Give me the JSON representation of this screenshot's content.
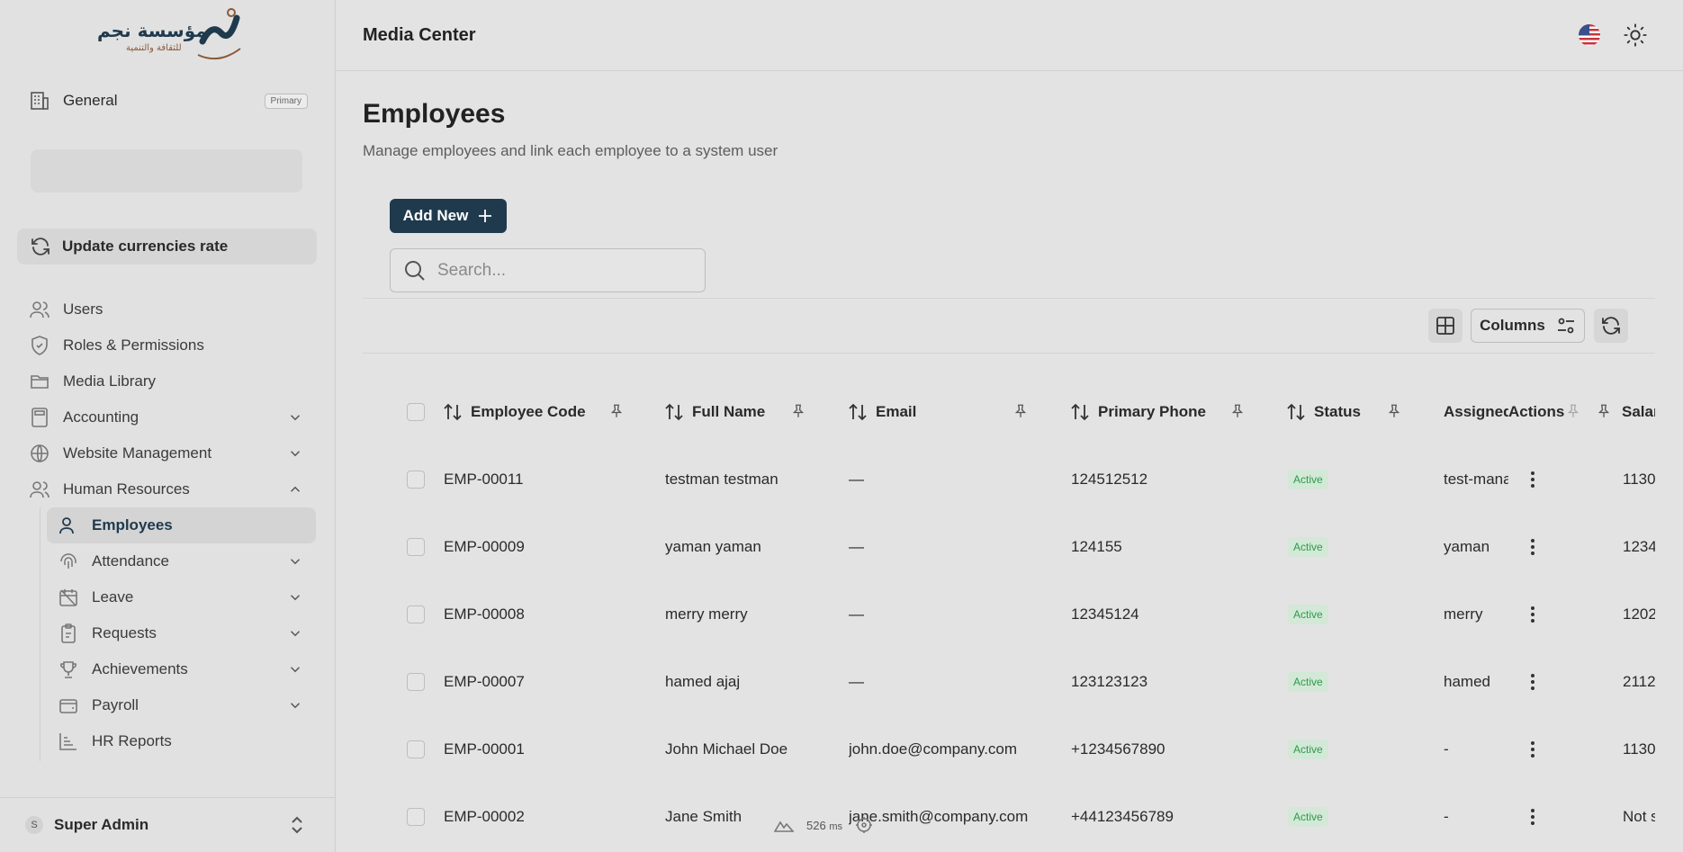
{
  "sidebar": {
    "logo": {
      "title": "مؤسسة نجم",
      "subtitle": "للثقافة والتنمية"
    },
    "org": {
      "label": "General",
      "badge": "Primary"
    },
    "update_button": "Update currencies rate",
    "nav": [
      {
        "label": "Users",
        "icon": "users-icon"
      },
      {
        "label": "Roles & Permissions",
        "icon": "shield-icon"
      },
      {
        "label": "Media Library",
        "icon": "folder-icon"
      },
      {
        "label": "Accounting",
        "icon": "calculator-icon",
        "expandable": true
      },
      {
        "label": "Website Management",
        "icon": "globe-icon",
        "expandable": true
      },
      {
        "label": "Human Resources",
        "icon": "users-icon",
        "expandable": true,
        "expanded": true
      }
    ],
    "hr_sub": [
      {
        "label": "Employees",
        "icon": "user-icon",
        "active": true
      },
      {
        "label": "Attendance",
        "icon": "fingerprint-icon",
        "expandable": true
      },
      {
        "label": "Leave",
        "icon": "calendar-off-icon",
        "expandable": true
      },
      {
        "label": "Requests",
        "icon": "clipboard-icon",
        "expandable": true
      },
      {
        "label": "Achievements",
        "icon": "trophy-icon",
        "expandable": true
      },
      {
        "label": "Payroll",
        "icon": "wallet-icon",
        "expandable": true
      },
      {
        "label": "HR Reports",
        "icon": "bar-chart-icon"
      }
    ],
    "footer": {
      "avatar": "S",
      "name": "Super Admin"
    }
  },
  "header": {
    "title": "Media Center"
  },
  "main": {
    "title": "Employees",
    "subtitle": "Manage employees and link each employee to a system user",
    "add_button": "Add New",
    "search_placeholder": "Search...",
    "columns_button": "Columns"
  },
  "table": {
    "headers": [
      "Employee Code",
      "Full Name",
      "Email",
      "Primary Phone",
      "Status",
      "Assigned User",
      "Actions",
      "Salary"
    ],
    "rows": [
      {
        "code": "EMP-00011",
        "name": "testman testman",
        "email": "—",
        "phone": "124512512",
        "status": "Active",
        "assigned": "test-manager",
        "salary": "1130"
      },
      {
        "code": "EMP-00009",
        "name": "yaman yaman",
        "email": "—",
        "phone": "124155",
        "status": "Active",
        "assigned": "yaman",
        "salary": "1234"
      },
      {
        "code": "EMP-00008",
        "name": "merry merry",
        "email": "—",
        "phone": "12345124",
        "status": "Active",
        "assigned": "merry",
        "salary": "1202"
      },
      {
        "code": "EMP-00007",
        "name": "hamed ajaj",
        "email": "—",
        "phone": "123123123",
        "status": "Active",
        "assigned": "hamed",
        "salary": "2112"
      },
      {
        "code": "EMP-00001",
        "name": "John Michael Doe",
        "email": "john.doe@company.com",
        "phone": "+1234567890",
        "status": "Active",
        "assigned": "-",
        "salary": "1130"
      },
      {
        "code": "EMP-00002",
        "name": "Jane Smith",
        "email": "jane.smith@company.com",
        "phone": "+44123456789",
        "status": "Active",
        "assigned": "-",
        "salary": "Not s"
      }
    ]
  },
  "perf": {
    "time": "526",
    "unit": "ms"
  },
  "colors": {
    "brand": "#1f3a4d",
    "active_green": "#2a9d4a"
  }
}
